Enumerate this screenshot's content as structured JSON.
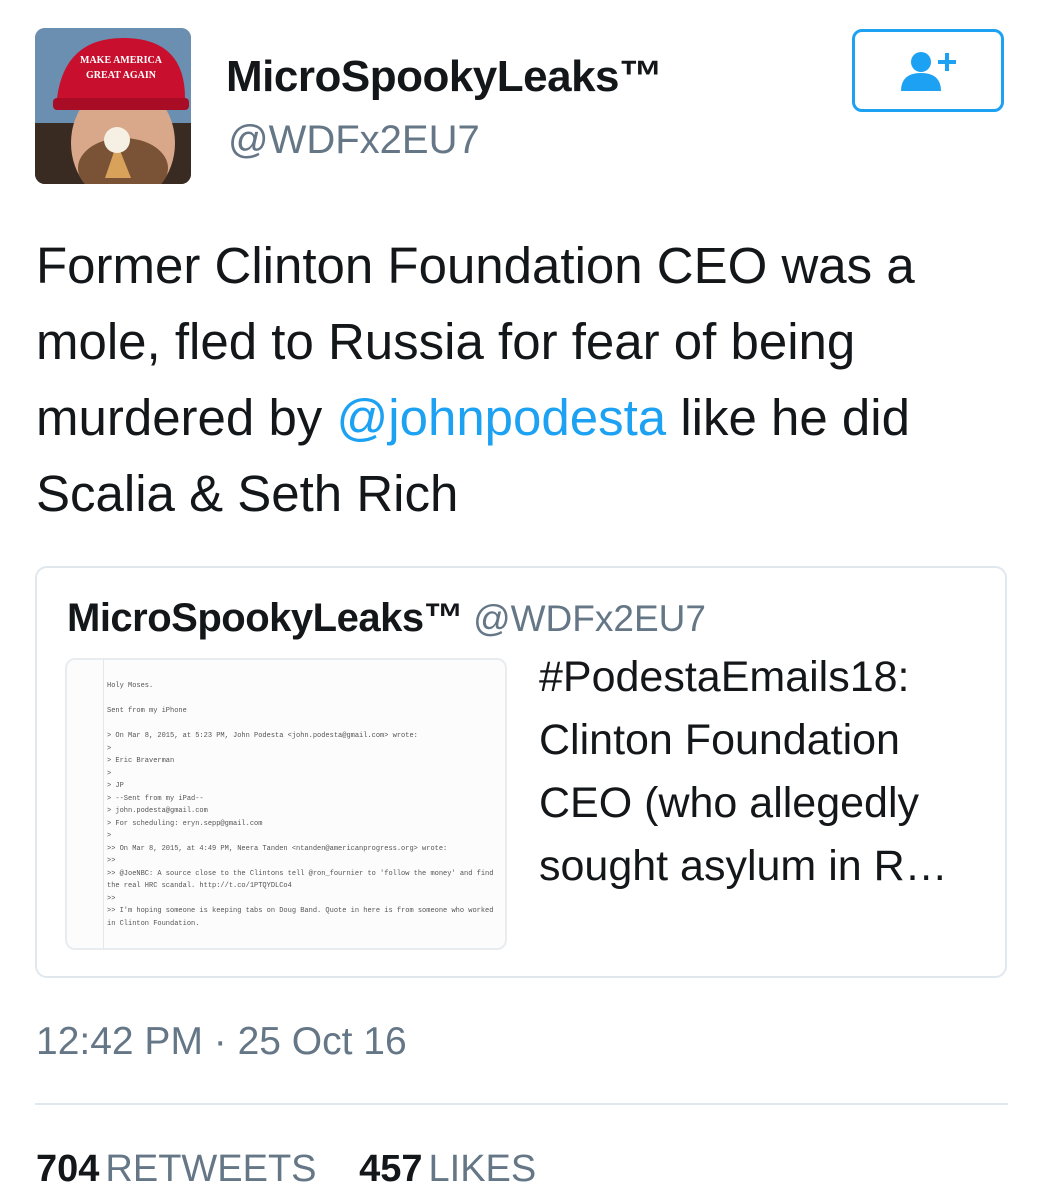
{
  "tweet": {
    "author": {
      "display_name": "MicroSpookyLeaks™",
      "handle": "@WDFx2EU7",
      "avatar_hat_text_1": "MAKE AMERICA",
      "avatar_hat_text_2": "GREAT AGAIN"
    },
    "follow_button_icon": "add-user-icon",
    "text_before": "Former Clinton Foundation CEO was a mole, fled to Russia for fear of being murdered by ",
    "mention": "@johnpodesta",
    "text_after": " like he did Scalia & Seth Rich",
    "quoted": {
      "display_name": "MicroSpookyLeaks™",
      "handle": "@WDFx2EU7",
      "text": "#PodestaEmails18: Clinton Foundation CEO (who allegedly sought asylum in R…",
      "image_lines": [
        "Holy Moses.",
        "",
        "Sent from my iPhone",
        "",
        "> On Mar 8, 2015, at 5:23 PM, John Podesta <john.podesta@gmail.com> wrote:",
        ">",
        "> Eric Braverman",
        ">",
        "> JP",
        "> --Sent from my iPad--",
        "> john.podesta@gmail.com",
        "> For scheduling: eryn.sepp@gmail.com",
        ">",
        ">> On Mar 8, 2015, at 4:49 PM, Neera Tanden <ntanden@americanprogress.org> wrote:",
        ">>",
        ">> @JoeNBC: A source close to the Clintons tell @ron_fournier to 'follow the money' and find the real HRC scandal. http://t.co/1PTQYDLCo4",
        ">>",
        ">> I'm hoping someone is keeping tabs on Doug Band. Quote in here is from someone who worked in Clinton Foundation."
      ]
    },
    "timestamp": "12:42 PM · 25 Oct 16",
    "retweets_count": "704",
    "retweets_label": "RETWEETS",
    "likes_count": "457",
    "likes_label": "LIKES"
  },
  "colors": {
    "accent": "#1da1f2",
    "secondary_text": "#657786",
    "border": "#e1e8ed"
  }
}
